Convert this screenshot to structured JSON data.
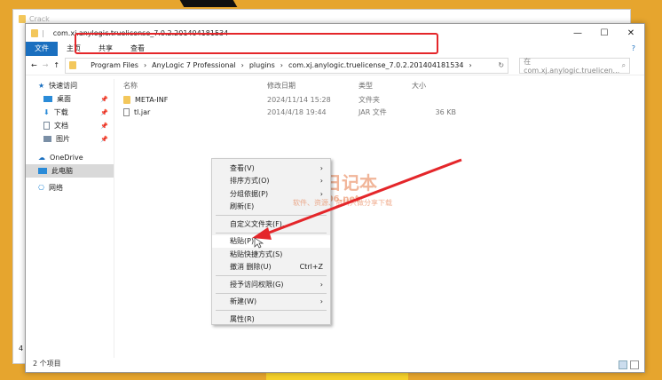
{
  "back_window": {
    "title": "Crack",
    "side_number": "4"
  },
  "window": {
    "title": "com.xj.anylogic.truelicense_7.0.2.201404181534",
    "controls": [
      "—",
      "☐",
      "✕"
    ]
  },
  "ribbon": {
    "tabs": [
      "文件",
      "主页",
      "共享",
      "查看"
    ]
  },
  "address": {
    "crumbs": [
      "Program Files",
      "AnyLogic 7 Professional",
      "plugins",
      "com.xj.anylogic.truelicense_7.0.2.201404181534"
    ],
    "search_placeholder": "在 com.xj.anylogic.truelicen..."
  },
  "sidebar": {
    "items": [
      {
        "label": "快速访问",
        "icon": "star-icon"
      },
      {
        "label": "桌面",
        "icon": "desktop-icon",
        "pinned": true
      },
      {
        "label": "下载",
        "icon": "download-icon",
        "pinned": true
      },
      {
        "label": "文档",
        "icon": "document-icon",
        "pinned": true
      },
      {
        "label": "图片",
        "icon": "picture-icon",
        "pinned": true
      },
      {
        "label": "OneDrive",
        "icon": "cloud-icon"
      },
      {
        "label": "此电脑",
        "icon": "computer-icon"
      },
      {
        "label": "网络",
        "icon": "network-icon"
      }
    ]
  },
  "columns": [
    "名称",
    "修改日期",
    "类型",
    "大小"
  ],
  "files": [
    {
      "name": "META-INF",
      "date": "2024/11/14 15:28",
      "type": "文件夹",
      "size": ""
    },
    {
      "name": "tl.jar",
      "date": "2014/4/18 19:44",
      "type": "JAR 文件",
      "size": "36 KB"
    }
  ],
  "status": "2 个项目",
  "context_menu": {
    "items": [
      "查看(V)",
      "排序方式(O)",
      "分组依据(P)",
      "刷新(E)",
      "自定义文件夹(F)...",
      "粘贴(P)",
      "粘贴快捷方式(S)",
      "撤消 删除(U)",
      "授予访问权限(G)",
      "新建(W)",
      "属性(R)"
    ],
    "shortcut": "Ctrl+Z"
  },
  "watermark": {
    "title": "丁同学日记本",
    "url": "www.ts006.net",
    "tagline": "软件、资源、资料只做分享下载"
  },
  "colors": {
    "background": "#E6A52E",
    "highlight": "#E4262A",
    "accent": "#1A6FBF"
  }
}
